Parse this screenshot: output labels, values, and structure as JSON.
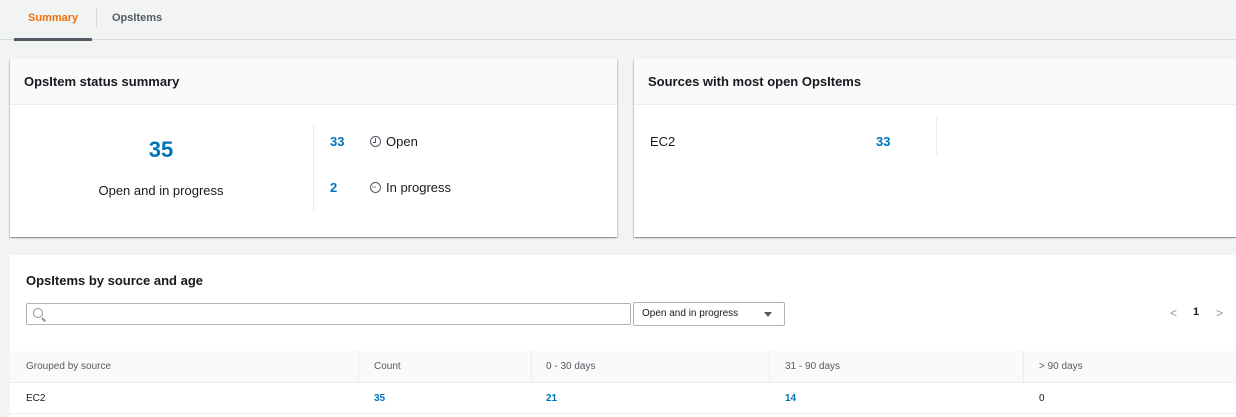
{
  "tabs": [
    {
      "label": "Summary",
      "active": true
    },
    {
      "label": "OpsItems",
      "active": false
    }
  ],
  "status_summary": {
    "title": "OpsItem status summary",
    "total": "35",
    "total_label": "Open and in progress",
    "open_count": "33",
    "open_label": "Open",
    "progress_count": "2",
    "progress_label": "In progress"
  },
  "sources": {
    "title": "Sources with most open OpsItems",
    "items": [
      {
        "name": "EC2",
        "count": "33"
      }
    ]
  },
  "age": {
    "title": "OpsItems by source and age",
    "search_placeholder": "",
    "filter_value": "Open and in progress",
    "page": "1",
    "prev_glyph": "<",
    "next_glyph": ">",
    "columns": [
      "Grouped by source",
      "Count",
      "0 - 30 days",
      "31 - 90 days",
      "> 90 days"
    ],
    "rows": [
      {
        "source": "EC2",
        "count": "35",
        "d0_30": "21",
        "d31_90": "14",
        "d90": "0"
      }
    ]
  },
  "colors": {
    "accent": "#ec7211",
    "link": "#0073bb"
  }
}
